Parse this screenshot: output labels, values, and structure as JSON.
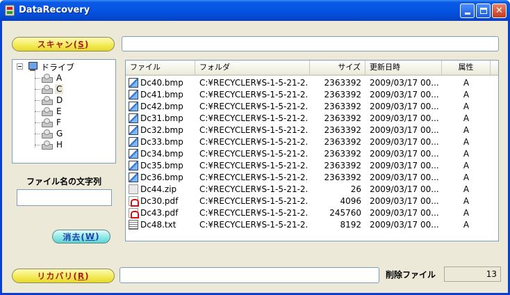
{
  "window": {
    "title": "DataRecovery",
    "accent": "#0a5ae6"
  },
  "buttons": {
    "scan": {
      "label": "スキャン(",
      "mnemonic": "S",
      "suffix": ")"
    },
    "clear": {
      "label": "消去(",
      "mnemonic": "W",
      "suffix": ")"
    },
    "recover": {
      "label": "リカバリ(",
      "mnemonic": "R",
      "suffix": ")"
    }
  },
  "tree": {
    "root_label": "ドライブ",
    "drives": [
      "A",
      "C",
      "D",
      "E",
      "F",
      "G",
      "H"
    ],
    "selected": "C"
  },
  "filter": {
    "label": "ファイル名の文字列",
    "value": ""
  },
  "scan_path": {
    "value": ""
  },
  "recover_path": {
    "value": ""
  },
  "file_list": {
    "columns": [
      "ファイル",
      "フォルダ",
      "サイズ",
      "更新日時",
      "属性"
    ],
    "rows": [
      {
        "icon": "bmp",
        "name": "Dc40.bmp",
        "folder": "C:¥RECYCLER¥S-1-5-21-2...",
        "size": "2363392",
        "date": "2009/03/17 00...",
        "attr": "A"
      },
      {
        "icon": "bmp",
        "name": "Dc41.bmp",
        "folder": "C:¥RECYCLER¥S-1-5-21-2...",
        "size": "2363392",
        "date": "2009/03/17 00...",
        "attr": "A"
      },
      {
        "icon": "bmp",
        "name": "Dc42.bmp",
        "folder": "C:¥RECYCLER¥S-1-5-21-2...",
        "size": "2363392",
        "date": "2009/03/17 00...",
        "attr": "A"
      },
      {
        "icon": "bmp",
        "name": "Dc31.bmp",
        "folder": "C:¥RECYCLER¥S-1-5-21-2...",
        "size": "2363392",
        "date": "2009/03/17 00...",
        "attr": "A"
      },
      {
        "icon": "bmp",
        "name": "Dc32.bmp",
        "folder": "C:¥RECYCLER¥S-1-5-21-2...",
        "size": "2363392",
        "date": "2009/03/17 00...",
        "attr": "A"
      },
      {
        "icon": "bmp",
        "name": "Dc33.bmp",
        "folder": "C:¥RECYCLER¥S-1-5-21-2...",
        "size": "2363392",
        "date": "2009/03/17 00...",
        "attr": "A"
      },
      {
        "icon": "bmp",
        "name": "Dc34.bmp",
        "folder": "C:¥RECYCLER¥S-1-5-21-2...",
        "size": "2363392",
        "date": "2009/03/17 00...",
        "attr": "A"
      },
      {
        "icon": "bmp",
        "name": "Dc35.bmp",
        "folder": "C:¥RECYCLER¥S-1-5-21-2...",
        "size": "2363392",
        "date": "2009/03/17 00...",
        "attr": "A"
      },
      {
        "icon": "bmp",
        "name": "Dc36.bmp",
        "folder": "C:¥RECYCLER¥S-1-5-21-2...",
        "size": "2363392",
        "date": "2009/03/17 00...",
        "attr": "A"
      },
      {
        "icon": "zip",
        "name": "Dc44.zip",
        "folder": "C:¥RECYCLER¥S-1-5-21-2...",
        "size": "26",
        "date": "2009/03/17 00...",
        "attr": "A"
      },
      {
        "icon": "pdf",
        "name": "Dc30.pdf",
        "folder": "C:¥RECYCLER¥S-1-5-21-2...",
        "size": "4096",
        "date": "2009/03/17 00...",
        "attr": "A"
      },
      {
        "icon": "pdf",
        "name": "Dc43.pdf",
        "folder": "C:¥RECYCLER¥S-1-5-21-2...",
        "size": "245760",
        "date": "2009/03/17 00...",
        "attr": "A"
      },
      {
        "icon": "txt",
        "name": "Dc48.txt",
        "folder": "C:¥RECYCLER¥S-1-5-21-2...",
        "size": "8192",
        "date": "2009/03/17 00...",
        "attr": "A"
      }
    ]
  },
  "deleted": {
    "label": "削除ファイル",
    "count": "13"
  }
}
